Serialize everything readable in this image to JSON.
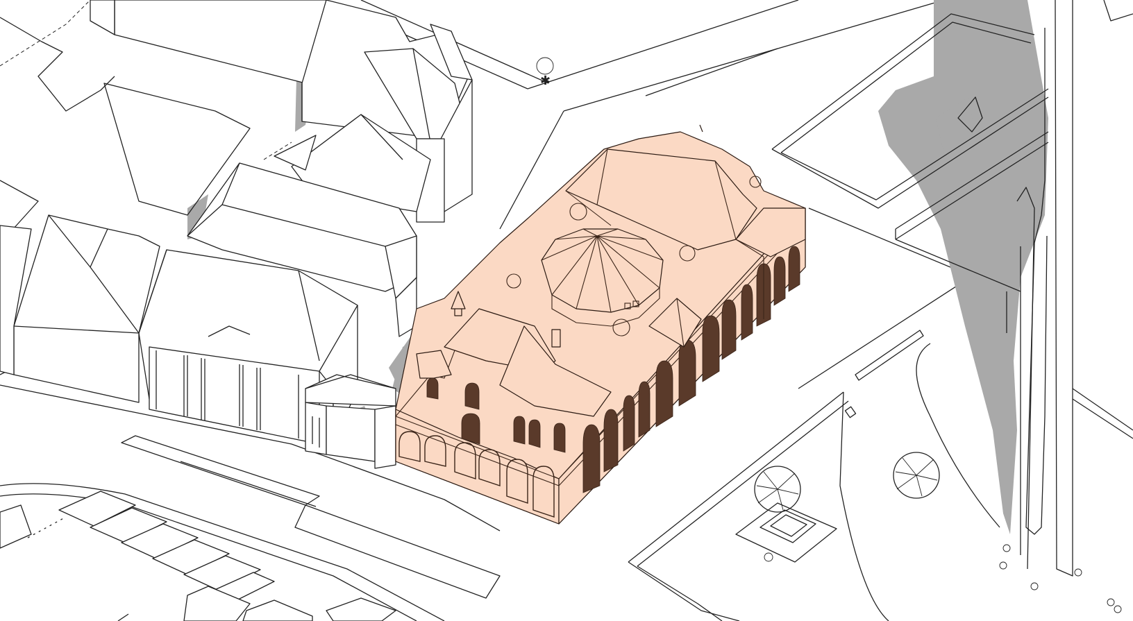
{
  "scene": {
    "kind": "isometric site massing drawing",
    "colors": {
      "background": "#ffffff",
      "highlight_building": "#fbd9c4",
      "outline": "#222222",
      "shadow": "#a9a9a9"
    },
    "labels": []
  }
}
